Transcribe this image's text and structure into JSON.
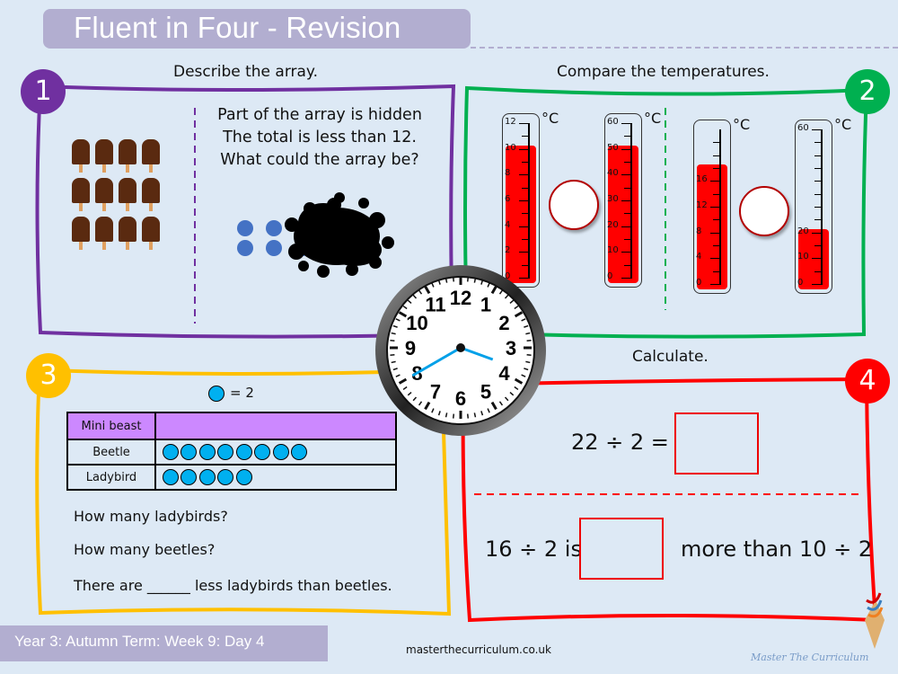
{
  "header": {
    "title": "Fluent in Four - Revision"
  },
  "q1": {
    "badge": "1",
    "heading": "Describe the array.",
    "popsicle_array": {
      "rows": 3,
      "cols": 4
    },
    "prompt_lines": [
      "Part of the array is hidden",
      "The total is less than 12.",
      "What could the array be?"
    ],
    "visible_counters": {
      "rows": 2,
      "cols": 2
    }
  },
  "q2": {
    "badge": "2",
    "heading": "Compare the temperatures.",
    "unit": "°C",
    "pairs": [
      {
        "left": {
          "labels": [
            "0",
            "2",
            "4",
            "6",
            "8",
            "10",
            "12"
          ],
          "max": 12,
          "value": 10
        },
        "right": {
          "labels": [
            "0",
            "10",
            "20",
            "30",
            "40",
            "50",
            "60"
          ],
          "max": 60,
          "value": 50
        }
      },
      {
        "left": {
          "labels": [
            "0",
            "4",
            "8",
            "12",
            "16"
          ],
          "max": 24,
          "value": 18
        },
        "right": {
          "labels": [
            "0",
            "10",
            "20",
            "60"
          ],
          "max": 60,
          "value": 20
        }
      }
    ]
  },
  "clock": {
    "time": "3:40",
    "numbers": [
      "12",
      "1",
      "2",
      "3",
      "4",
      "5",
      "6",
      "7",
      "8",
      "9",
      "10",
      "11"
    ]
  },
  "q3": {
    "badge": "3",
    "key_text": "= 2",
    "table": {
      "header": [
        "Mini beast",
        ""
      ],
      "rows": [
        {
          "label": "Beetle",
          "symbols": 8
        },
        {
          "label": "Ladybird",
          "symbols": 5
        }
      ]
    },
    "questions": [
      "How many ladybirds?",
      "How many beetles?",
      "There are ______ less ladybirds than beetles."
    ]
  },
  "q4": {
    "badge": "4",
    "heading": "Calculate.",
    "eq1": "22 ÷ 2 =",
    "eq2_left": "16 ÷ 2 is",
    "eq2_right": "more than 10 ÷ 2"
  },
  "footer": {
    "lesson": "Year 3: Autumn Term: Week 9: Day 4",
    "site": "masterthecurriculum.co.uk",
    "brand": "Master The Curriculum"
  },
  "colors": {
    "purple": "#7030a0",
    "green": "#00b050",
    "yellow": "#ffc000",
    "red": "#ff0000",
    "counter": "#00b0f0",
    "thermo_fill": "#ff0000"
  }
}
